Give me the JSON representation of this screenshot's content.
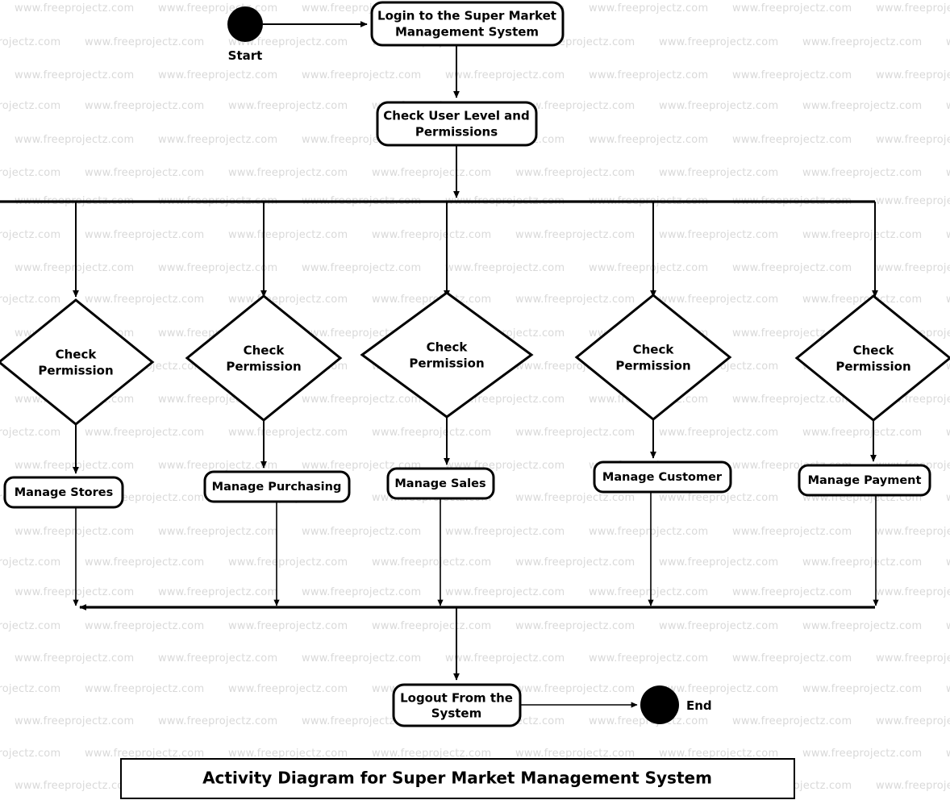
{
  "diagram": {
    "title": "Activity Diagram for Super Market Management System",
    "watermark_text": "www.freeprojectz.com",
    "colors": {
      "stroke": "#000000",
      "fill": "#ffffff",
      "watermark": "#d9d9d9"
    },
    "start_node": {
      "label": "Start",
      "shape": "filled-circle"
    },
    "end_node": {
      "label": "End",
      "shape": "filled-circle"
    },
    "activities": {
      "login": "Login to the Super Market Management System",
      "check_user": "Check User Level and Permissions",
      "logout": "Logout From the System"
    },
    "decisions": [
      {
        "id": "d1",
        "label_line1": "Check",
        "label_line2": "Permission"
      },
      {
        "id": "d2",
        "label_line1": "Check",
        "label_line2": "Permission"
      },
      {
        "id": "d3",
        "label_line1": "Check",
        "label_line2": "Permission"
      },
      {
        "id": "d4",
        "label_line1": "Check",
        "label_line2": "Permission"
      },
      {
        "id": "d5",
        "label_line1": "Check",
        "label_line2": "Permission"
      }
    ],
    "manage_actions": [
      {
        "id": "m1",
        "label": "Manage Stores"
      },
      {
        "id": "m2",
        "label": "Manage Purchasing"
      },
      {
        "id": "m3",
        "label": "Manage Sales"
      },
      {
        "id": "m4",
        "label": "Manage Customer"
      },
      {
        "id": "m5",
        "label": "Manage Payment"
      }
    ],
    "login_lines": [
      "Login to the Super Market",
      "Management System"
    ],
    "check_user_lines": [
      "Check User Level and",
      "Permissions"
    ],
    "logout_lines": [
      "Logout From the",
      "System"
    ]
  }
}
